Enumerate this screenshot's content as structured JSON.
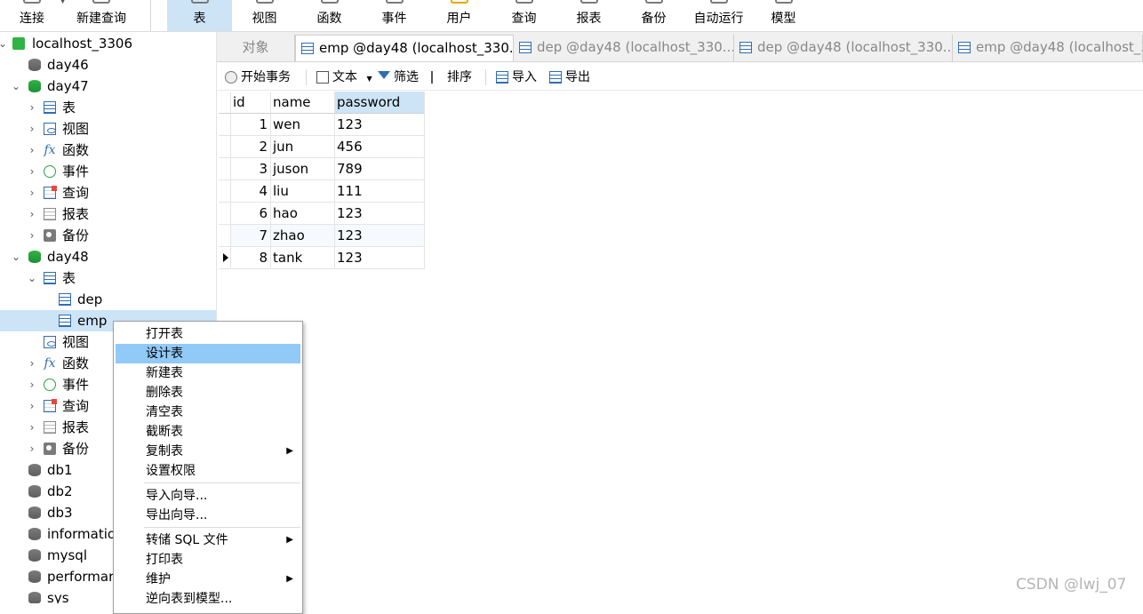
{
  "toolbar": {
    "items": [
      {
        "label": "连接"
      },
      {
        "label": "新建查询"
      },
      {
        "label": "表"
      },
      {
        "label": "视图"
      },
      {
        "label": "函数"
      },
      {
        "label": "事件"
      },
      {
        "label": "用户"
      },
      {
        "label": "查询"
      },
      {
        "label": "报表"
      },
      {
        "label": "备份"
      },
      {
        "label": "自动运行"
      },
      {
        "label": "模型"
      }
    ]
  },
  "tree": {
    "connection": "localhost_3306",
    "db_day46": "day46",
    "db_day47": "day47",
    "day47_children": [
      "表",
      "视图",
      "函数",
      "事件",
      "查询",
      "报表",
      "备份"
    ],
    "db_day48": "day48",
    "day48_table_group": "表",
    "day48_tables": [
      "dep",
      "emp"
    ],
    "day48_children": [
      "视图",
      "函数",
      "事件",
      "查询",
      "报表",
      "备份"
    ],
    "other_dbs": [
      "db1",
      "db2",
      "db3",
      "informatio",
      "mysql",
      "performar",
      "sys"
    ]
  },
  "tabs": {
    "objects": "对象",
    "items": [
      {
        "label": "emp @day48 (localhost_330..."
      },
      {
        "label": "dep @day48 (localhost_330..."
      },
      {
        "label": "dep @day48 (localhost_330..."
      },
      {
        "label": "emp @day48 (localhost_3"
      }
    ]
  },
  "subtoolbar": {
    "begin_tx": "开始事务",
    "text": "文本",
    "filter": "筛选",
    "sort": "排序",
    "import": "导入",
    "export": "导出"
  },
  "grid": {
    "columns": [
      "id",
      "name",
      "password"
    ],
    "rows": [
      {
        "id": "1",
        "name": "wen",
        "password": "123"
      },
      {
        "id": "2",
        "name": "jun",
        "password": "456"
      },
      {
        "id": "3",
        "name": "juson",
        "password": "789"
      },
      {
        "id": "4",
        "name": "liu",
        "password": "111"
      },
      {
        "id": "6",
        "name": "hao",
        "password": "123"
      },
      {
        "id": "7",
        "name": "zhao",
        "password": "123"
      },
      {
        "id": "8",
        "name": "tank",
        "password": "123"
      }
    ]
  },
  "context_menu": {
    "items": [
      {
        "label": "打开表"
      },
      {
        "label": "设计表"
      },
      {
        "label": "新建表"
      },
      {
        "label": "删除表"
      },
      {
        "label": "清空表"
      },
      {
        "label": "截断表"
      },
      {
        "label": "复制表"
      },
      {
        "label": "设置权限"
      },
      {
        "label": "导入向导..."
      },
      {
        "label": "导出向导..."
      },
      {
        "label": "转储 SQL 文件"
      },
      {
        "label": "打印表"
      },
      {
        "label": "维护"
      },
      {
        "label": "逆向表到模型..."
      }
    ]
  },
  "watermark": "CSDN @lwj_07"
}
